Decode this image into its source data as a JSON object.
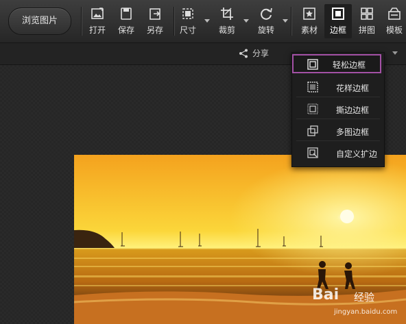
{
  "toolbar": {
    "browse_label": "浏览图片",
    "tools": [
      {
        "label": "打开",
        "icon": "open-image-icon"
      },
      {
        "label": "保存",
        "icon": "save-icon"
      },
      {
        "label": "另存",
        "icon": "save-as-icon"
      },
      {
        "label": "尺寸",
        "icon": "resize-icon"
      },
      {
        "label": "裁剪",
        "icon": "crop-icon"
      },
      {
        "label": "旋转",
        "icon": "rotate-icon"
      },
      {
        "label": "素材",
        "icon": "material-icon"
      },
      {
        "label": "边框",
        "icon": "border-icon",
        "active": true
      },
      {
        "label": "拼图",
        "icon": "collage-icon"
      },
      {
        "label": "模板",
        "icon": "template-icon"
      }
    ]
  },
  "subbar": {
    "share_label": "分享"
  },
  "border_menu": {
    "highlight_color": "#a451a6",
    "items": [
      {
        "label": "轻松边框",
        "icon": "simple-border-icon",
        "selected": true
      },
      {
        "label": "花样边框",
        "icon": "pattern-border-icon"
      },
      {
        "label": "撕边边框",
        "icon": "torn-edge-border-icon"
      },
      {
        "label": "多图边框",
        "icon": "multi-image-border-icon"
      },
      {
        "label": "自定义扩边",
        "icon": "custom-extend-border-icon"
      }
    ]
  },
  "watermark": {
    "brand": "Bai",
    "text": "经验",
    "url": "jingyan.baidu.com"
  }
}
